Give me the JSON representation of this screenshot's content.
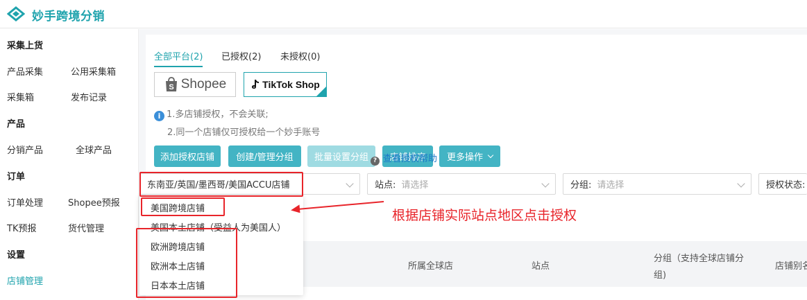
{
  "header": {
    "title": "妙手跨境分销",
    "logo_icon": "diamond-logo-icon"
  },
  "sidebar": {
    "sections": [
      {
        "title": "采集上货",
        "items": [
          "产品采集",
          "公用采集箱",
          "采集箱",
          "发布记录"
        ]
      },
      {
        "title": "产品",
        "items": [
          "分销产品",
          "全球产品"
        ]
      },
      {
        "title": "订单",
        "items": [
          "订单处理",
          "Shopee预报",
          "TK预报",
          "货代管理"
        ]
      },
      {
        "title": "设置",
        "items": [
          "店铺管理"
        ]
      }
    ],
    "active_item": "店铺管理"
  },
  "tabs": [
    "全部平台(2)",
    "已授权(2)",
    "未授权(0)"
  ],
  "platforms": {
    "shopee": "Shopee",
    "tiktok": "TikTok Shop"
  },
  "info": {
    "line1": "1.多店铺授权，不会关联;",
    "line2": "2.同一个店铺仅可授权给一个妙手账号"
  },
  "buttons": {
    "add_shop": "添加授权店铺",
    "manage_group": "创建/管理分组",
    "batch_group": "批量设置分组",
    "sort": "店铺排序",
    "more": "更多操作"
  },
  "help_link": "查看授权帮助",
  "filters": {
    "region_value": "东南亚/英国/墨西哥/美国ACCU店铺",
    "site_label": "站点:",
    "site_placeholder": "请选择",
    "group_label": "分组:",
    "group_placeholder": "请选择",
    "auth_label": "授权状态:"
  },
  "dropdown_options": [
    "美国跨境店铺",
    "美国本土店铺（受益人为美国人）",
    "欧洲跨境店铺",
    "欧洲本土店铺",
    "日本本土店铺"
  ],
  "table_headers": {
    "global_shop": "所属全球店",
    "site": "站点",
    "group_line1": "分组（支持全球店铺分",
    "group_line2": "组)",
    "alias": "店铺别名"
  },
  "annotation": "根据店铺实际站点地区点击授权",
  "colors": {
    "accent": "#1fa3ad",
    "button": "#43b4c4",
    "button_disabled": "#9fdbe2",
    "annotation": "#e8242a",
    "link": "#1e78c8"
  }
}
